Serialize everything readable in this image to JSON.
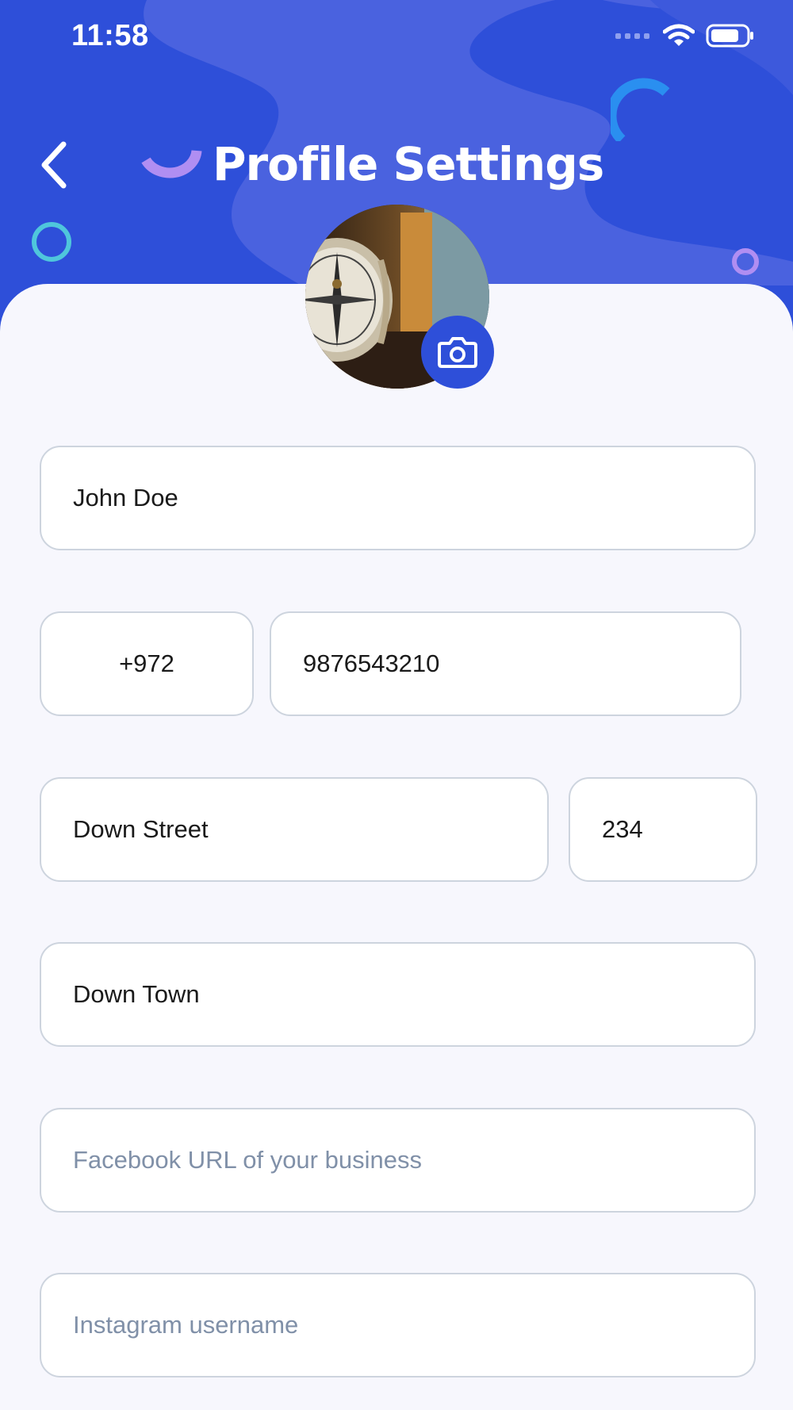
{
  "status_bar": {
    "time": "11:58",
    "icons": [
      "signal-icon",
      "wifi-icon",
      "battery-icon"
    ]
  },
  "header": {
    "title": "Profile Settings",
    "back_icon": "chevron-left-icon",
    "background_color": "#2e4fd9"
  },
  "profile": {
    "avatar": "compass-photo",
    "camera_icon": "camera-icon"
  },
  "form": {
    "full_name": {
      "value": "John Doe",
      "placeholder": ""
    },
    "country_code": {
      "value": "+972",
      "placeholder": ""
    },
    "phone": {
      "value": "9876543210",
      "placeholder": ""
    },
    "street": {
      "value": "Down Street",
      "placeholder": ""
    },
    "house_number": {
      "value": "234",
      "placeholder": ""
    },
    "city": {
      "value": "Down Town",
      "placeholder": ""
    },
    "facebook": {
      "value": "",
      "placeholder": "Facebook URL of your business"
    },
    "instagram": {
      "value": "",
      "placeholder": "Instagram username"
    }
  },
  "colors": {
    "accent": "#2e4fd9",
    "field_border": "#cdd4de",
    "placeholder": "#8090a8",
    "page_background": "#f7f7fd"
  }
}
